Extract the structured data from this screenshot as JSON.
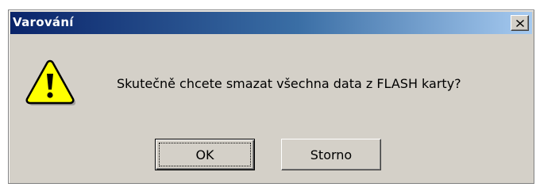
{
  "dialog": {
    "title": "Varování",
    "message": "Skutečně chcete smazat všechna data z FLASH karty?",
    "icon": "warning-icon",
    "close_icon": "close-icon",
    "buttons": {
      "ok_label": "OK",
      "cancel_label": "Storno"
    }
  },
  "colors": {
    "titlebar_start": "#0a246a",
    "titlebar_end": "#a6caf0",
    "face": "#d4d0c8",
    "warning_fill": "#ffff00"
  }
}
